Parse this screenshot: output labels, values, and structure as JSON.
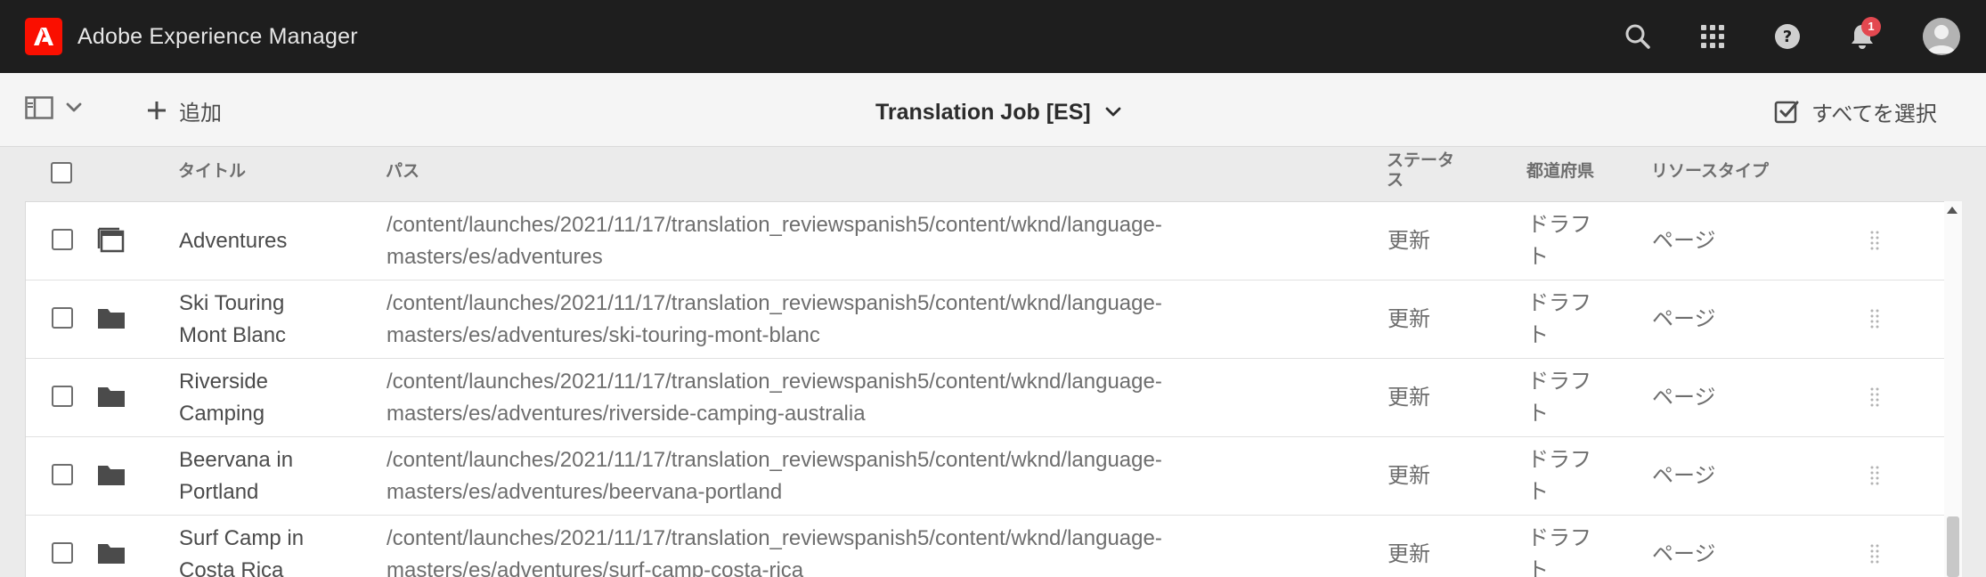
{
  "shell": {
    "app_title": "Adobe Experience Manager",
    "notification_count": "1",
    "icons": [
      "adobe-logo-icon",
      "search-icon",
      "apps-grid-icon",
      "help-icon",
      "bell-icon",
      "user-avatar-icon"
    ]
  },
  "actionbar": {
    "add_label": "追加",
    "title": "Translation Job [ES]",
    "select_all_label": "すべてを選択"
  },
  "table": {
    "headers": {
      "title": "タイトル",
      "path": "パス",
      "status_line1": "ステータ",
      "status_line2": "ス",
      "prefecture": "都道府県",
      "resource_type": "リソースタイプ"
    },
    "rows": [
      {
        "icon": "page-icon",
        "title_line1": "Adventures",
        "title_line2": "",
        "path_line1": "/content/launches/2021/11/17/translation_reviewspanish5/content/wknd/language-",
        "path_line2": "masters/es/adventures",
        "status": "更新",
        "state_line1": "ドラフ",
        "state_line2": "ト",
        "type": "ページ"
      },
      {
        "icon": "folder-icon",
        "title_line1": "Ski Touring",
        "title_line2": "Mont Blanc",
        "path_line1": "/content/launches/2021/11/17/translation_reviewspanish5/content/wknd/language-",
        "path_line2": "masters/es/adventures/ski-touring-mont-blanc",
        "status": "更新",
        "state_line1": "ドラフ",
        "state_line2": "ト",
        "type": "ページ"
      },
      {
        "icon": "folder-icon",
        "title_line1": "Riverside",
        "title_line2": "Camping",
        "path_line1": "/content/launches/2021/11/17/translation_reviewspanish5/content/wknd/language-",
        "path_line2": "masters/es/adventures/riverside-camping-australia",
        "status": "更新",
        "state_line1": "ドラフ",
        "state_line2": "ト",
        "type": "ページ"
      },
      {
        "icon": "folder-icon",
        "title_line1": "Beervana in",
        "title_line2": "Portland",
        "path_line1": "/content/launches/2021/11/17/translation_reviewspanish5/content/wknd/language-",
        "path_line2": "masters/es/adventures/beervana-portland",
        "status": "更新",
        "state_line1": "ドラフ",
        "state_line2": "ト",
        "type": "ページ"
      },
      {
        "icon": "folder-icon",
        "title_line1": "Surf Camp in",
        "title_line2": "Costa Rica",
        "path_line1": "/content/launches/2021/11/17/translation_reviewspanish5/content/wknd/language-",
        "path_line2": "masters/es/adventures/surf-camp-costa-rica",
        "status": "更新",
        "state_line1": "ドラフ",
        "state_line2": "ト",
        "type": "ページ"
      }
    ]
  }
}
